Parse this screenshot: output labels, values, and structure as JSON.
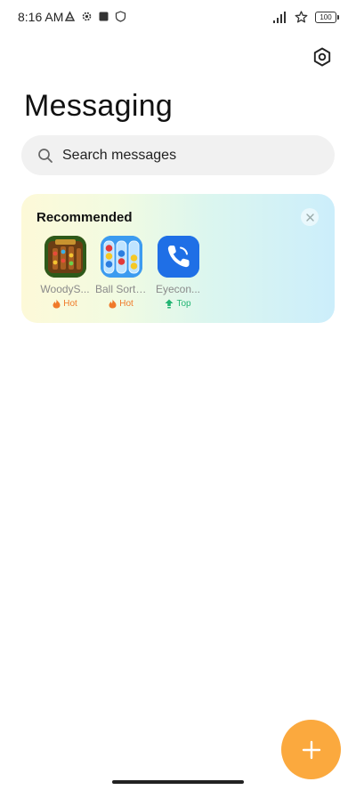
{
  "status_bar": {
    "time": "8:16 AM",
    "battery": "100"
  },
  "header": {
    "title": "Messaging"
  },
  "search": {
    "placeholder": "Search messages"
  },
  "recommended": {
    "title": "Recommended",
    "apps": [
      {
        "name": "WoodyS...",
        "badge": "Hot",
        "badge_type": "hot",
        "icon": "woody-game-icon"
      },
      {
        "name": "Ball Sort:...",
        "badge": "Hot",
        "badge_type": "hot",
        "icon": "ball-sort-icon"
      },
      {
        "name": "Eyecon...",
        "badge": "Top",
        "badge_type": "top",
        "icon": "phone-icon"
      }
    ]
  },
  "colors": {
    "fab": "#fba93e",
    "hot": "#f07a2a",
    "top": "#22b573",
    "eyecon": "#1a73e8"
  }
}
